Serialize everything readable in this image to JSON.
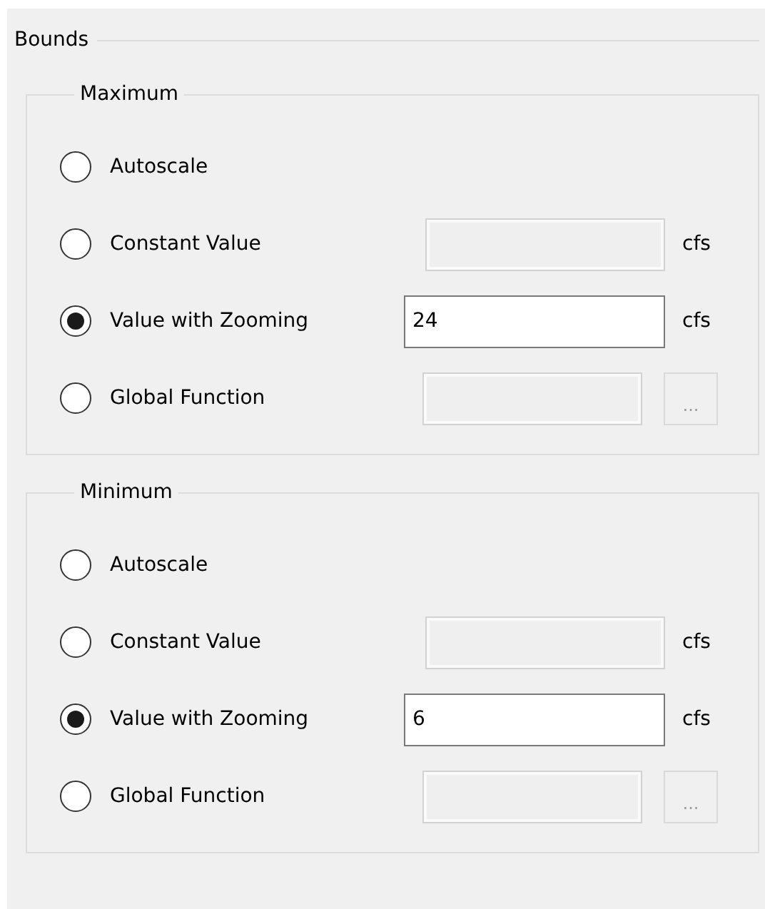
{
  "title": "Bounds",
  "groups": [
    {
      "title": "Maximum",
      "options": [
        {
          "kind": "plain",
          "label": "Autoscale",
          "selected": false
        },
        {
          "kind": "field",
          "label": "Constant Value",
          "selected": false,
          "field": {
            "enabled": false
          },
          "unit": "cfs"
        },
        {
          "kind": "field",
          "label": "Value with Zooming",
          "selected": true,
          "field": {
            "enabled": true,
            "value": "24"
          },
          "unit": "cfs"
        },
        {
          "kind": "browse",
          "label": "Global Function",
          "selected": false,
          "field": {
            "enabled": false
          },
          "button": {
            "label": "...",
            "disabled": true
          }
        }
      ]
    },
    {
      "title": "Minimum",
      "options": [
        {
          "kind": "plain",
          "label": "Autoscale",
          "selected": false
        },
        {
          "kind": "field",
          "label": "Constant Value",
          "selected": false,
          "field": {
            "enabled": false
          },
          "unit": "cfs"
        },
        {
          "kind": "field",
          "label": "Value with Zooming",
          "selected": true,
          "field": {
            "enabled": true,
            "value": "6"
          },
          "unit": "cfs"
        },
        {
          "kind": "browse",
          "label": "Global Function",
          "selected": false,
          "field": {
            "enabled": false
          },
          "button": {
            "label": "...",
            "disabled": true
          }
        }
      ]
    }
  ]
}
